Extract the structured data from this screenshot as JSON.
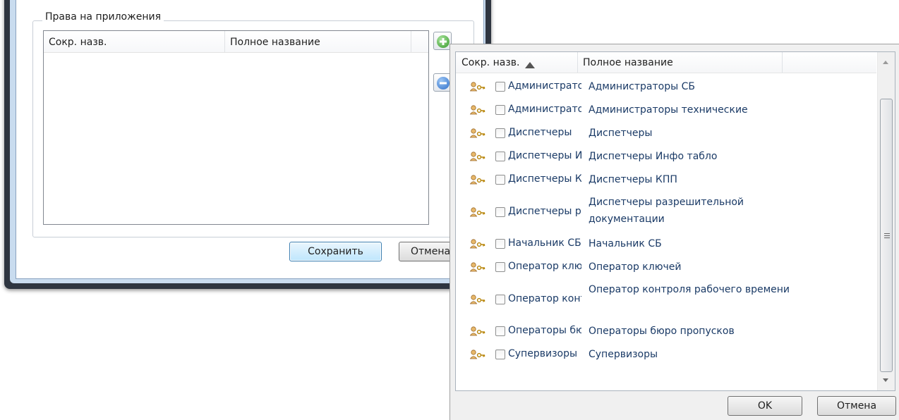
{
  "main_dialog": {
    "group_title": "Права на приложения",
    "columns": [
      "Сокр. назв.",
      "Полное название"
    ],
    "save_label": "Сохранить",
    "cancel_label": "Отмена"
  },
  "selector_dialog": {
    "columns": {
      "short": "Сокр. назв.",
      "full": "Полное название",
      "sort_short": "ascending"
    },
    "rows": [
      {
        "short": "Администраторы СБ",
        "full": "Администраторы СБ",
        "checked": false
      },
      {
        "short": "Администраторы технические",
        "full": "Администраторы технические",
        "checked": false
      },
      {
        "short": "Диспетчеры",
        "full": "Диспетчеры",
        "checked": false
      },
      {
        "short": "Диспетчеры Инфо табло",
        "full": "Диспетчеры Инфо табло",
        "checked": false
      },
      {
        "short": "Диспетчеры КПП",
        "full": "Диспетчеры КПП",
        "checked": false
      },
      {
        "short": "Диспетчеры разрешительной документации",
        "full": "Диспетчеры разрешительной документации",
        "checked": false
      },
      {
        "short": "Начальник СБ",
        "full": "Начальник СБ",
        "checked": false
      },
      {
        "short": "Оператор ключей",
        "full": "Оператор ключей",
        "checked": false
      },
      {
        "short": "Оператор контроля рабочего времени",
        "full": "Оператор контроля рабочего времени",
        "checked": false
      },
      {
        "short": "Операторы бюро пропусков",
        "full": "Операторы бюро пропусков",
        "checked": false
      },
      {
        "short": "Супервизоры",
        "full": "Супервизоры",
        "checked": false
      }
    ],
    "row_icon": "user-key-icon",
    "ok_label": "OK",
    "cancel_label": "Отмена"
  },
  "colors": {
    "link_text": "#1a3a66",
    "add_green": "#3a9a2e",
    "remove_blue": "#2f6fc9"
  }
}
